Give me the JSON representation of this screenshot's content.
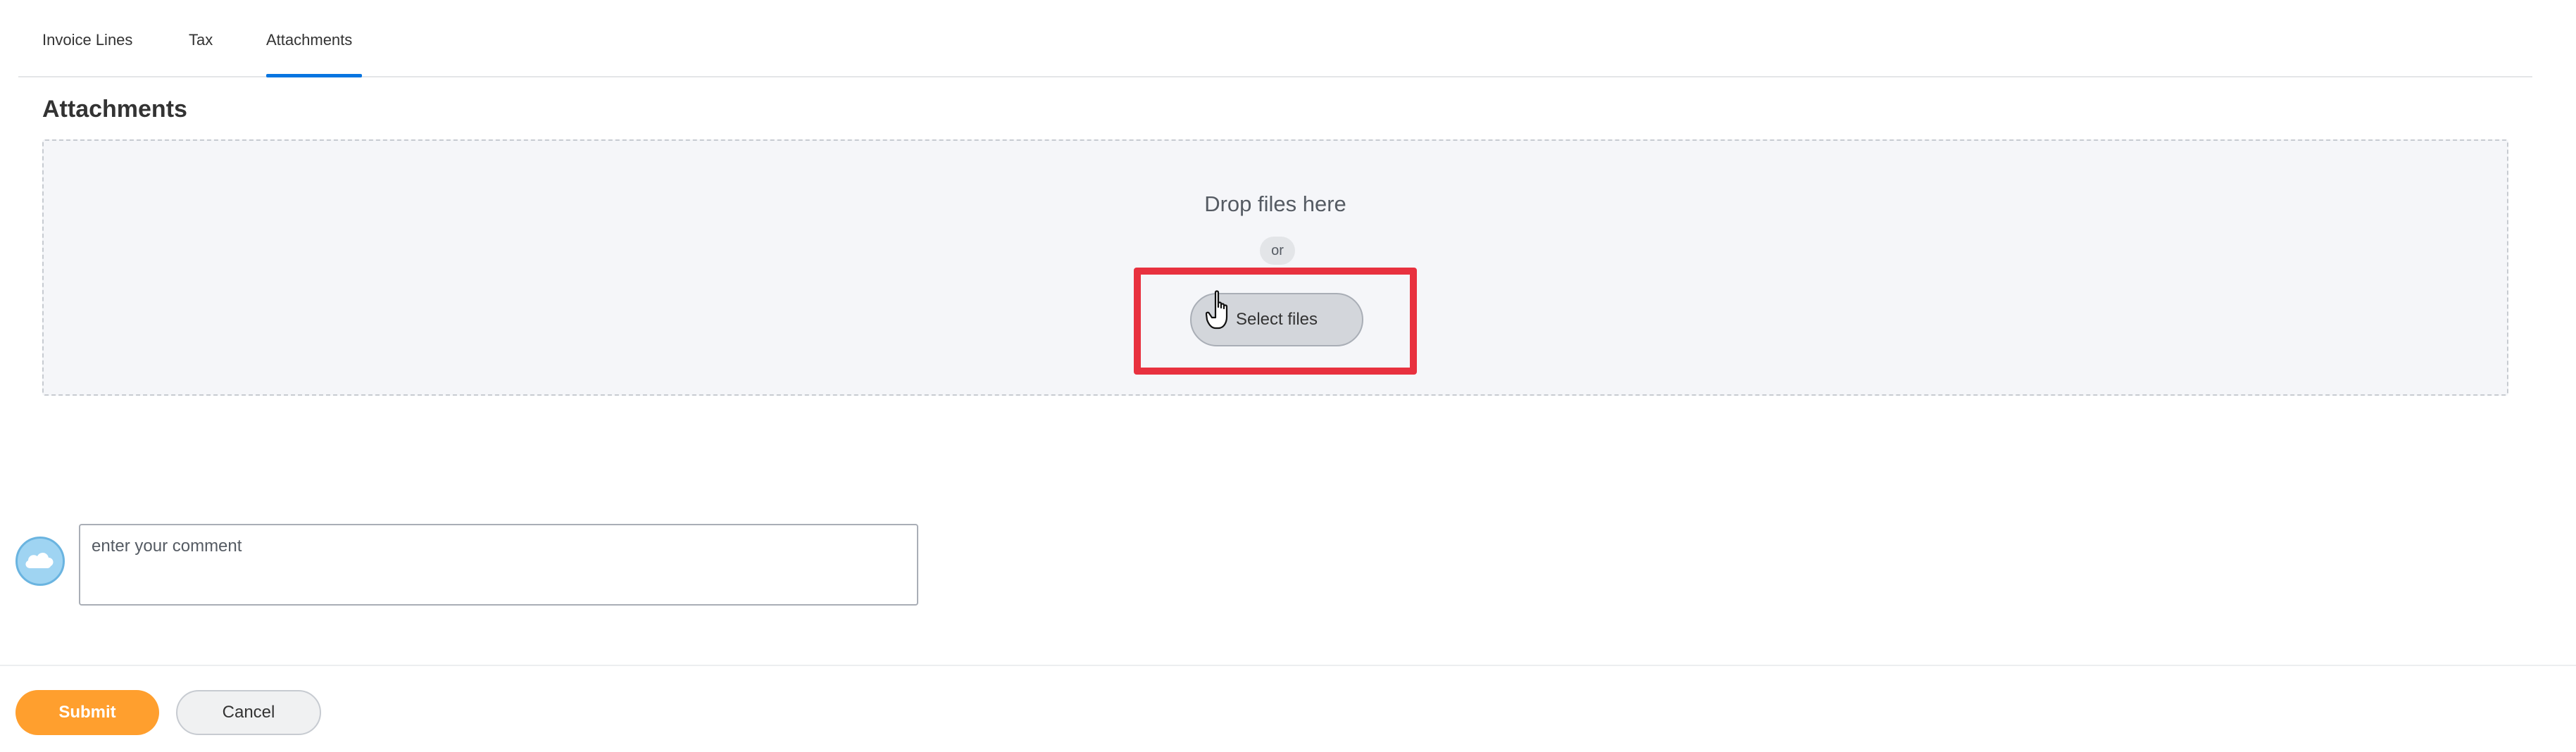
{
  "tabs": [
    {
      "label": "Invoice Lines",
      "active": false
    },
    {
      "label": "Tax",
      "active": false
    },
    {
      "label": "Attachments",
      "active": true
    }
  ],
  "section": {
    "title": "Attachments"
  },
  "dropzone": {
    "drop_text": "Drop files here",
    "or_text": "or",
    "select_label": "Select files"
  },
  "comment": {
    "placeholder": "enter your comment",
    "avatar_icon": "cloud-icon"
  },
  "footer": {
    "submit_label": "Submit",
    "cancel_label": "Cancel"
  },
  "colors": {
    "accent": "#0875e1",
    "submit": "#ff9f2e",
    "highlight": "#e8313f"
  }
}
